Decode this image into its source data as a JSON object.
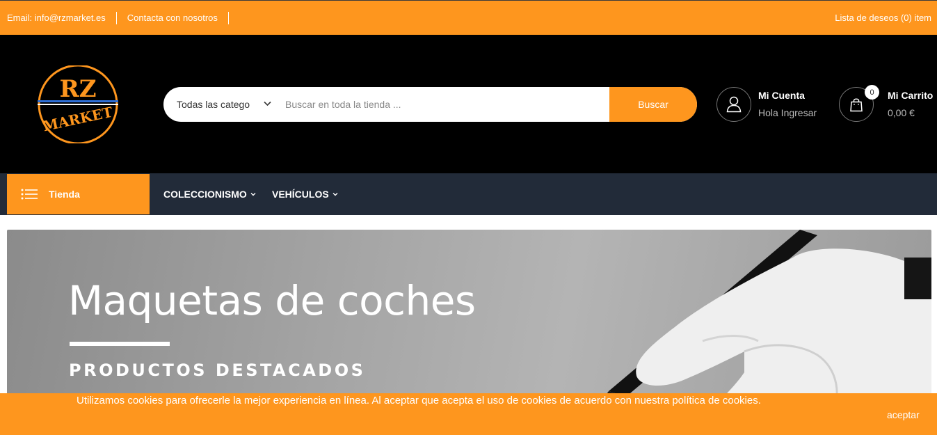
{
  "topbar": {
    "email": "Email: info@rzmarket.es",
    "contact": "Contacta con nosotros",
    "wishlist": "Lista de deseos (0) item"
  },
  "logo": {
    "line1": "RZ",
    "line2": "MARKET"
  },
  "search": {
    "category": "Todas las catego",
    "placeholder": "Buscar en toda la tienda ...",
    "button": "Buscar"
  },
  "account": {
    "title": "Mi Cuenta",
    "subtitle": "Hola Ingresar"
  },
  "cart": {
    "title": "Mi Carrito",
    "total": "0,00 €",
    "count": "0"
  },
  "nav": {
    "shop": "Tienda",
    "items": [
      {
        "label": "COLECCIONISMO"
      },
      {
        "label": "VEHÍCULOS"
      }
    ]
  },
  "hero": {
    "title": "Maquetas de coches",
    "subtitle": "PRODUCTOS DESTACADOS"
  },
  "cookies": {
    "text": "Utilizamos cookies para ofrecerle la mejor experiencia en línea. Al aceptar que acepta el uso de cookies de acuerdo con nuestra política de cookies.",
    "accept": "aceptar"
  },
  "colors": {
    "accent": "#fe961e",
    "header": "#000000",
    "nav": "#222b39"
  },
  "icons": [
    "user-icon",
    "cart-icon",
    "menu-list-icon",
    "chevron-down-icon"
  ]
}
